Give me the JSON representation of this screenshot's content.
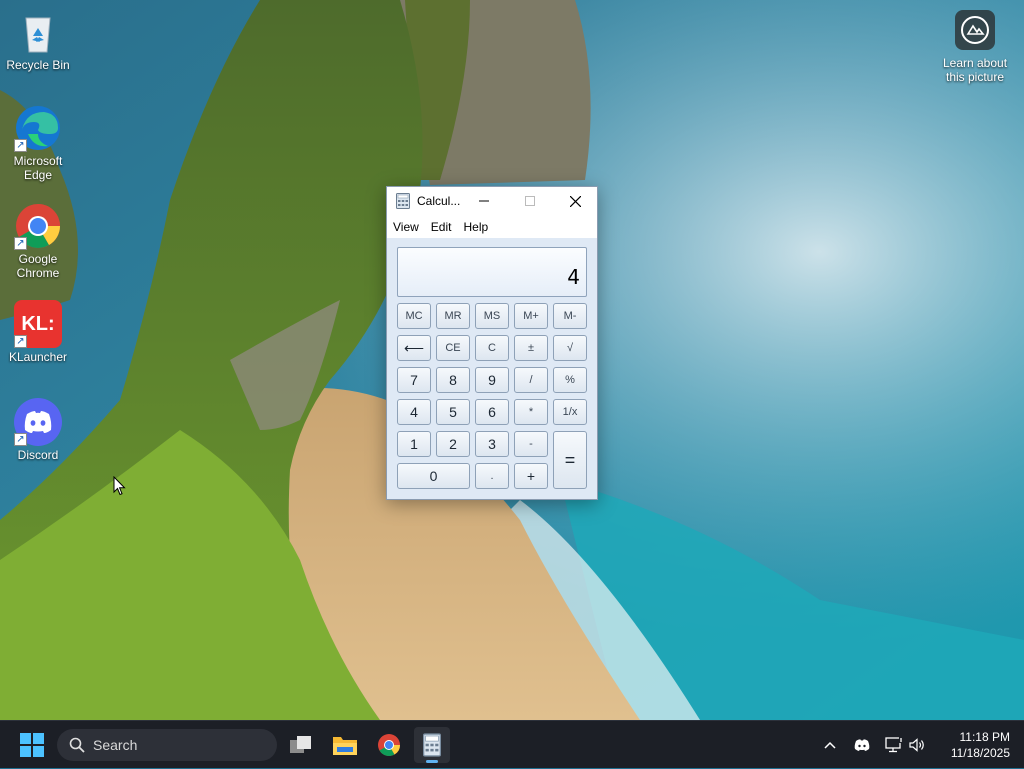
{
  "desktop": {
    "icons": [
      {
        "label": "Recycle Bin",
        "icon": "recycle-bin-icon"
      },
      {
        "label": "Microsoft Edge",
        "icon": "edge-icon"
      },
      {
        "label": "Google Chrome",
        "icon": "chrome-icon"
      },
      {
        "label": "KLauncher",
        "icon": "klauncher-icon",
        "badge": "KL:"
      },
      {
        "label": "Discord",
        "icon": "discord-icon"
      }
    ],
    "learn_label": "Learn about this picture"
  },
  "calculator": {
    "title": "Calcul...",
    "menu": [
      "View",
      "Edit",
      "Help"
    ],
    "display_value": "4",
    "memory_row": [
      "MC",
      "MR",
      "MS",
      "M+",
      "M-"
    ],
    "row2": [
      "⟵",
      "CE",
      "C",
      "±",
      "√"
    ],
    "row3": [
      "7",
      "8",
      "9",
      "/",
      "%"
    ],
    "row4": [
      "4",
      "5",
      "6",
      "*",
      "1/x"
    ],
    "row5": [
      "1",
      "2",
      "3",
      "-"
    ],
    "equals": "=",
    "row6": [
      "0",
      ".",
      "+"
    ]
  },
  "taskbar": {
    "search_placeholder": "Search",
    "time": "11:18 PM",
    "date": "11/18/2025",
    "pinned": [
      "task-view-icon",
      "file-explorer-icon",
      "chrome-icon",
      "calculator-icon"
    ],
    "tray": [
      "chevron-up-icon",
      "discord-icon",
      "network-icon",
      "volume-icon"
    ]
  },
  "colors": {
    "taskbar_bg": "#1c1f26",
    "calc_bg": "#dfe9f5",
    "active_indicator": "#5fb2f2"
  }
}
